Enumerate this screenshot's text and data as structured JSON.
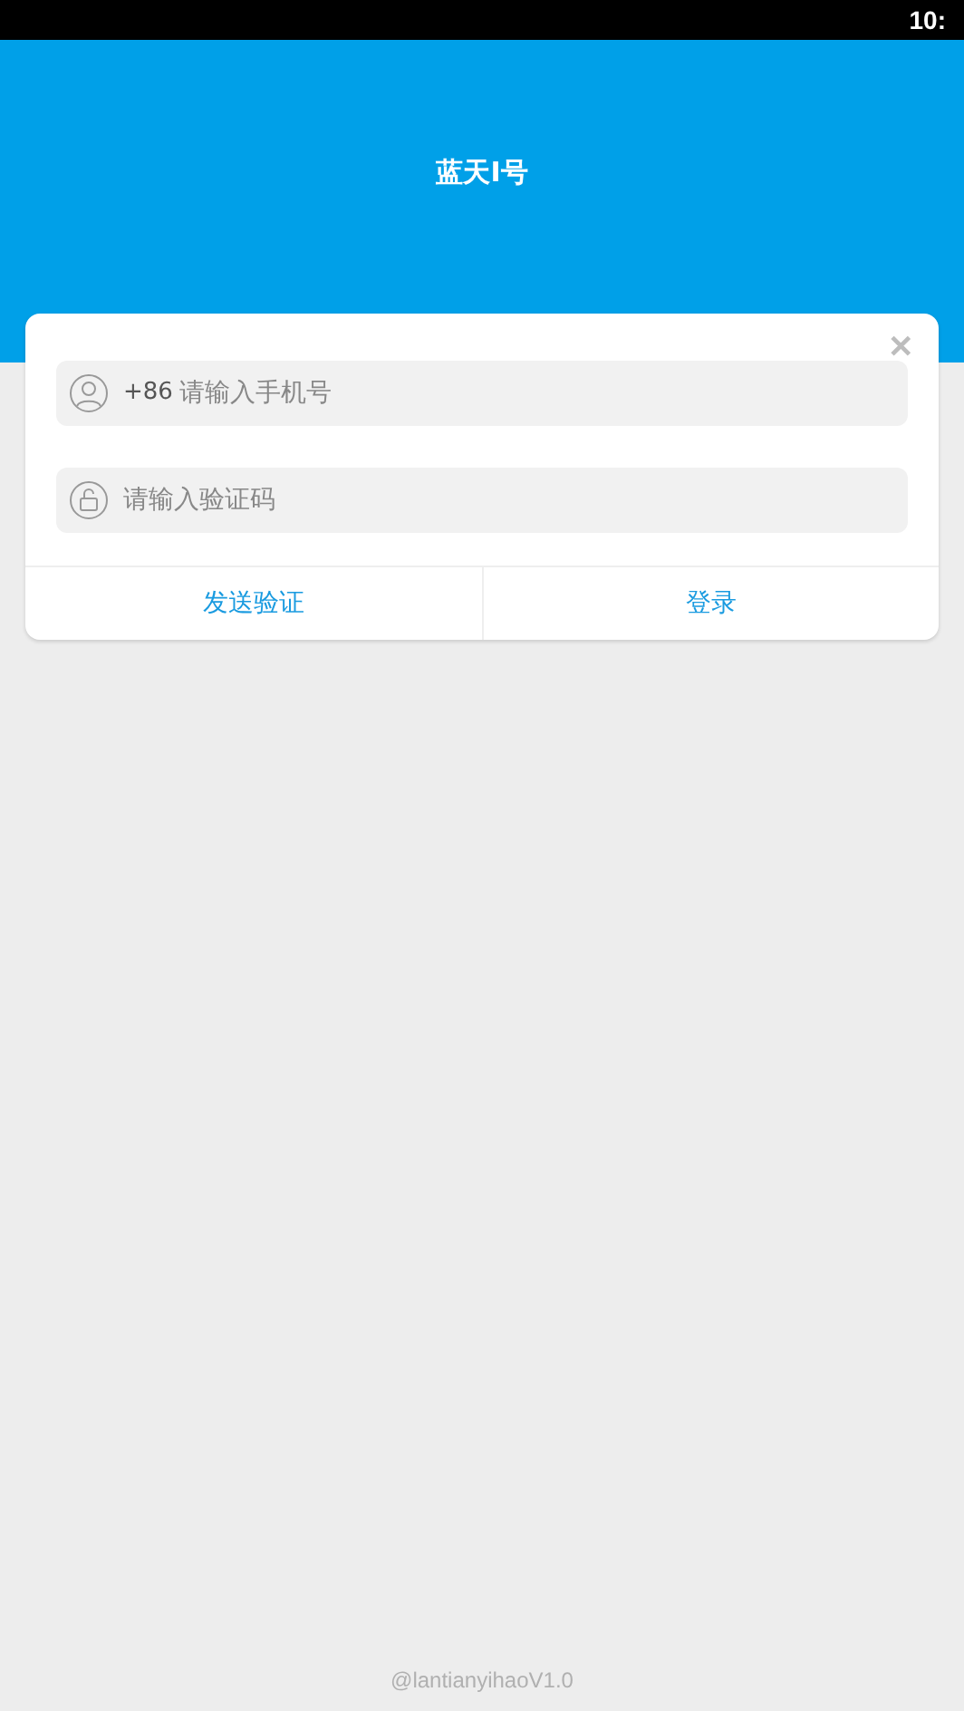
{
  "status_bar": {
    "time": "10:"
  },
  "header": {
    "title": "蓝天I号"
  },
  "login_card": {
    "close": "✕",
    "phone_field": {
      "prefix": "+86",
      "placeholder": "请输入手机号"
    },
    "code_field": {
      "placeholder": "请输入验证码"
    },
    "buttons": [
      "发送验证",
      "登录"
    ]
  },
  "footer": {
    "text": "@lantianyihaoV1.0"
  }
}
